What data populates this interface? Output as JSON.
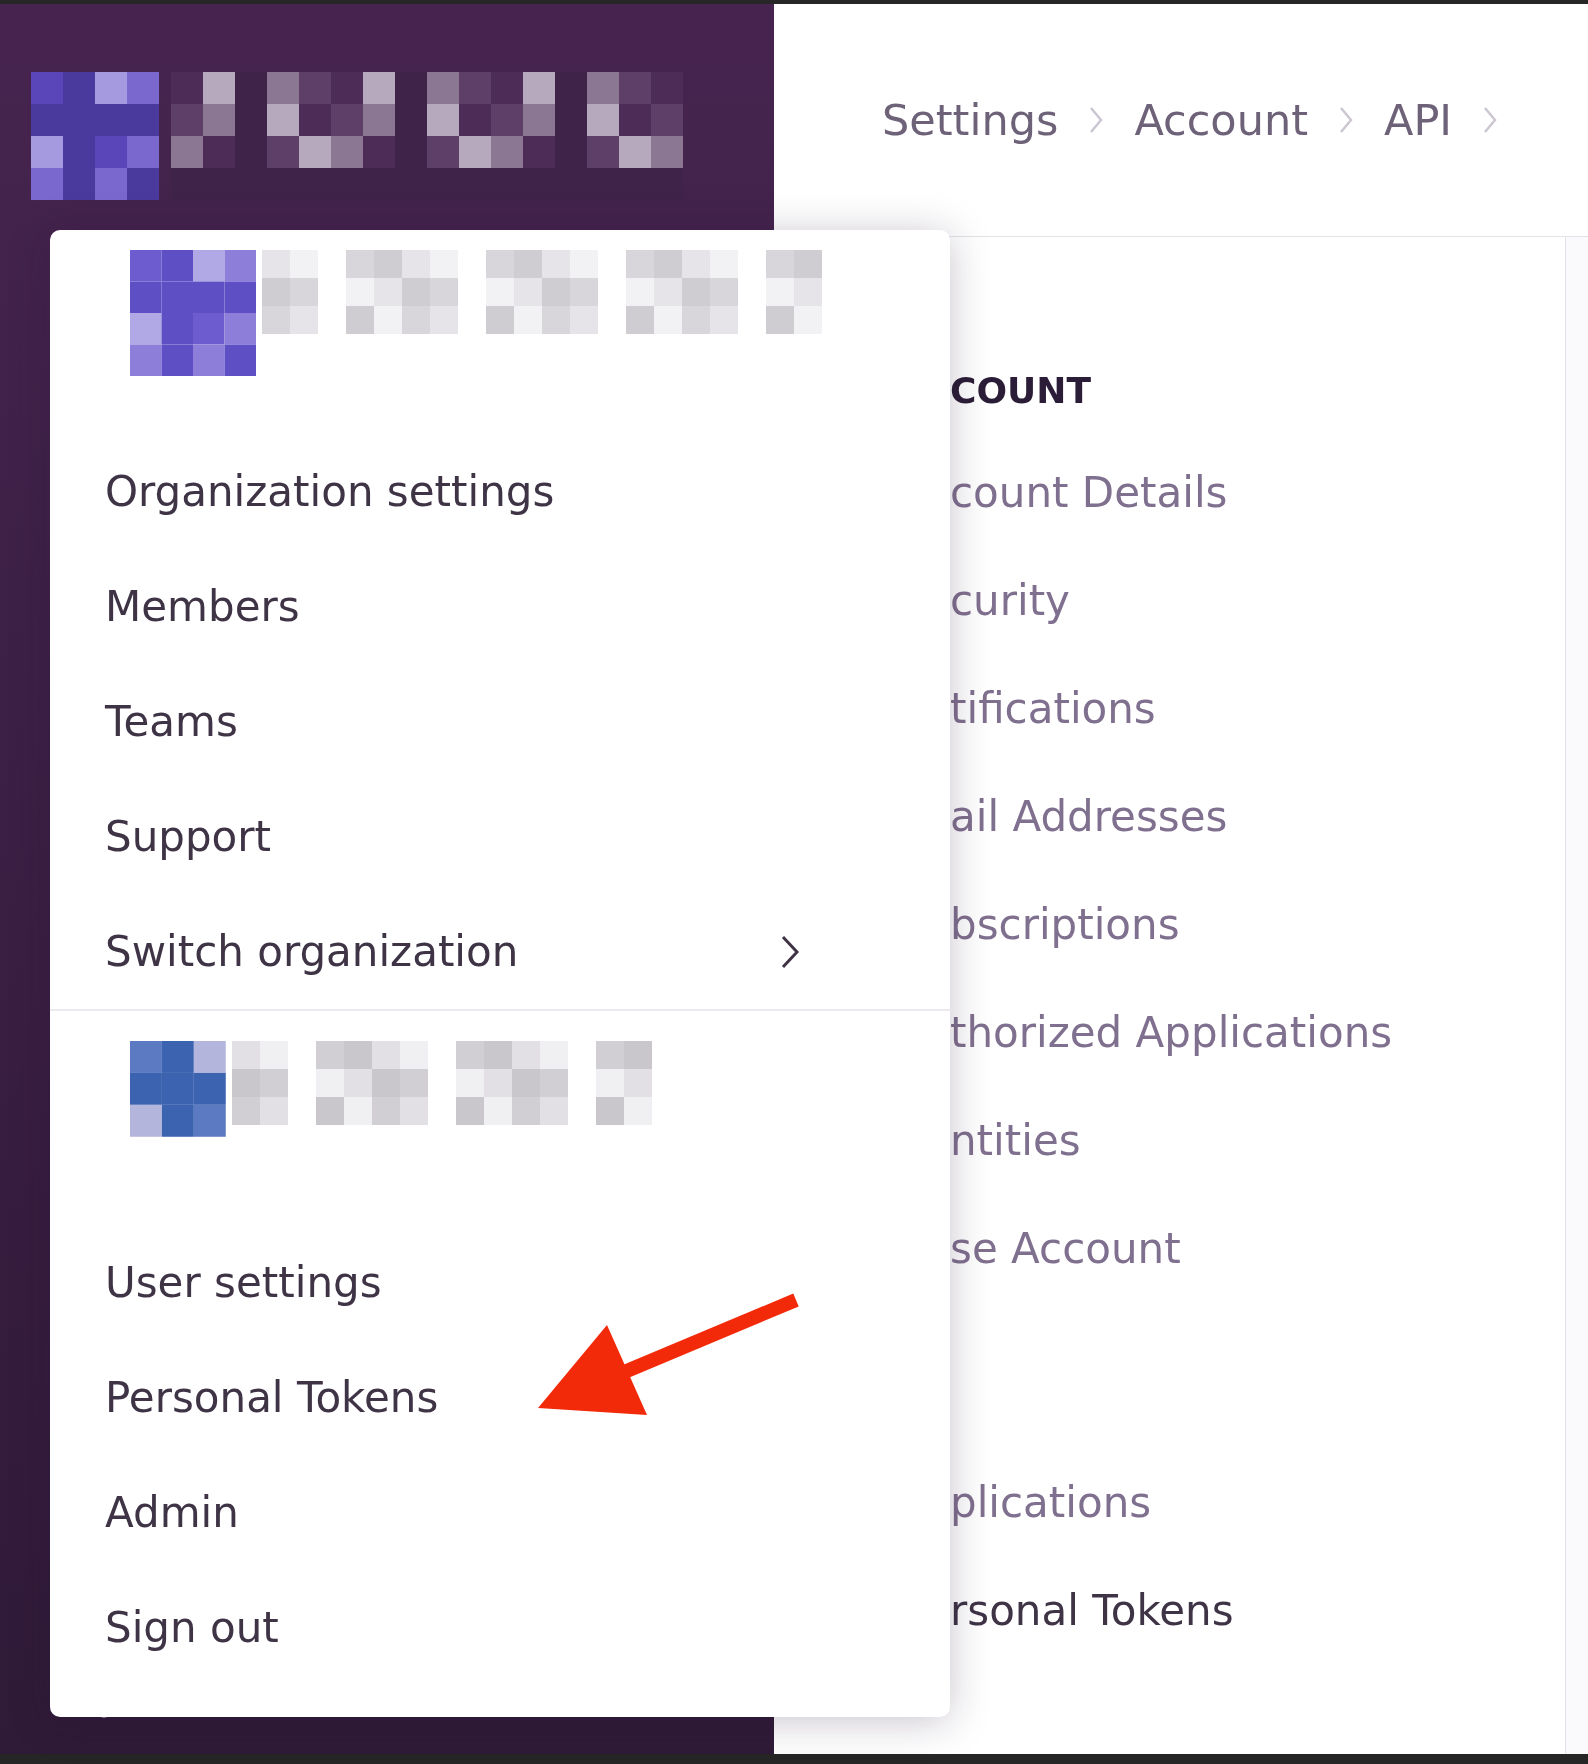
{
  "breadcrumbs": [
    "Settings",
    "Account",
    "API"
  ],
  "settings_nav": {
    "groups": [
      {
        "heading": "COUNT",
        "items": [
          {
            "label": "count Details",
            "selected": false
          },
          {
            "label": "curity",
            "selected": false
          },
          {
            "label": "tifications",
            "selected": false
          },
          {
            "label": "ail Addresses",
            "selected": false
          },
          {
            "label": "bscriptions",
            "selected": false
          },
          {
            "label": "thorized Applications",
            "selected": false
          },
          {
            "label": "ntities",
            "selected": false
          },
          {
            "label": "se Account",
            "selected": false
          }
        ]
      },
      {
        "items": [
          {
            "label": "plications",
            "selected": false
          },
          {
            "label": "rsonal Tokens",
            "selected": true
          }
        ]
      }
    ]
  },
  "menu": {
    "sections": [
      {
        "kind": "organization",
        "items": [
          {
            "label": "Organization settings",
            "has_submenu": false
          },
          {
            "label": "Members",
            "has_submenu": false
          },
          {
            "label": "Teams",
            "has_submenu": false
          },
          {
            "label": "Support",
            "has_submenu": false
          },
          {
            "label": "Switch organization",
            "has_submenu": true
          }
        ]
      },
      {
        "kind": "user",
        "items": [
          {
            "label": "User settings",
            "has_submenu": false
          },
          {
            "label": "Personal Tokens",
            "has_submenu": false
          },
          {
            "label": "Admin",
            "has_submenu": false
          },
          {
            "label": "Sign out",
            "has_submenu": false
          }
        ]
      }
    ]
  }
}
